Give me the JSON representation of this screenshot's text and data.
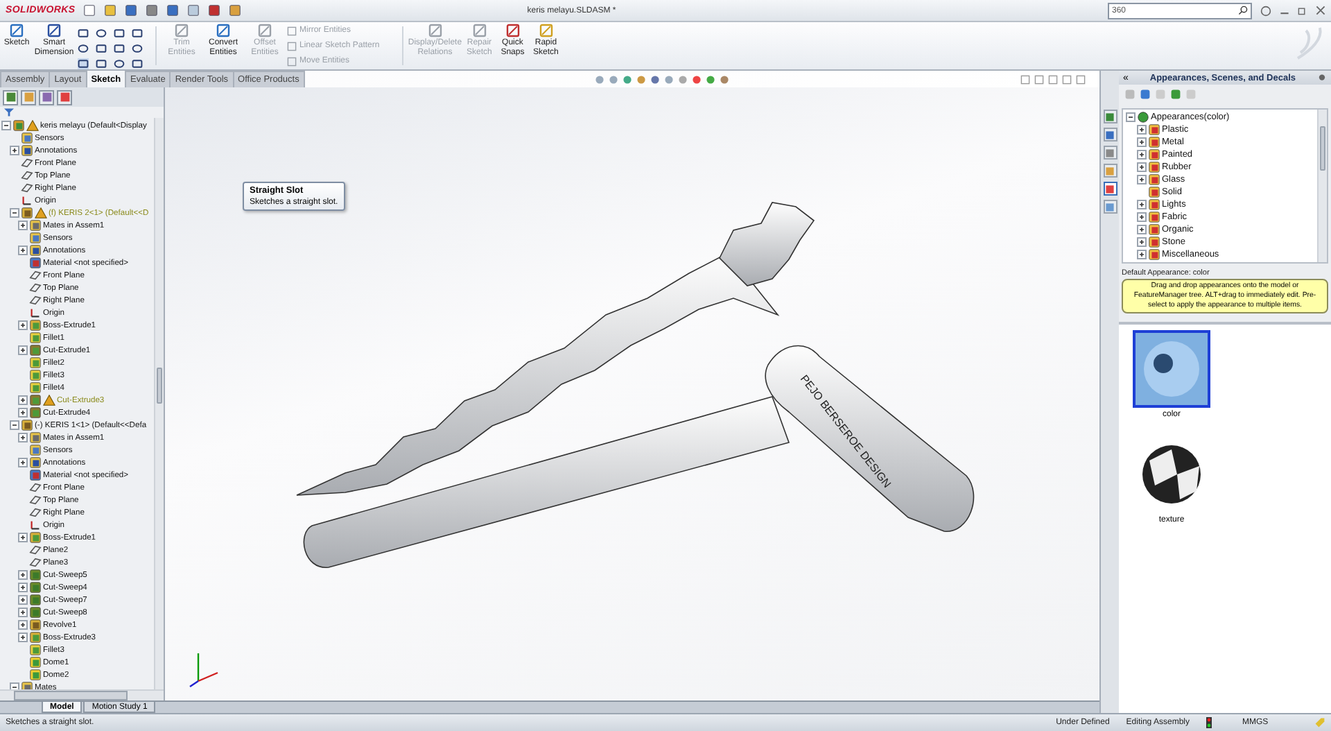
{
  "window": {
    "logo": "SOLIDWORKS",
    "title": "keris melayu.SLDASM *",
    "search": {
      "value": "360"
    }
  },
  "ribbon": {
    "large_buttons": [
      {
        "label": "Sketch",
        "disabled": false,
        "kind": "sketch"
      },
      {
        "label": "Smart Dimension",
        "disabled": false,
        "kind": "dimension"
      }
    ],
    "edit_buttons": [
      {
        "label": "Trim Entities",
        "disabled": true,
        "kind": "trim"
      },
      {
        "label": "Convert Entities",
        "disabled": false,
        "kind": "convert"
      },
      {
        "label": "Offset Entities",
        "disabled": true,
        "kind": "offset"
      }
    ],
    "small_buttons": [
      {
        "label": "Mirror Entities",
        "disabled": true
      },
      {
        "label": "Linear Sketch Pattern",
        "disabled": true
      },
      {
        "label": "Move Entities",
        "disabled": true
      }
    ],
    "relation_buttons": [
      {
        "label": "Display/Delete Relations",
        "disabled": true,
        "kind": "relations"
      },
      {
        "label": "Repair Sketch",
        "disabled": true,
        "kind": "repair"
      },
      {
        "label": "Quick Snaps",
        "disabled": false,
        "kind": "snaps"
      },
      {
        "label": "Rapid Sketch",
        "disabled": false,
        "kind": "rapid"
      }
    ]
  },
  "tabs": [
    {
      "label": "Assembly",
      "selected": false
    },
    {
      "label": "Layout",
      "selected": false
    },
    {
      "label": "Sketch",
      "selected": true
    },
    {
      "label": "Evaluate",
      "selected": false
    },
    {
      "label": "Render Tools",
      "selected": false
    },
    {
      "label": "Office Products",
      "selected": false
    }
  ],
  "tooltip": {
    "title": "Straight Slot",
    "text": "Sketches a straight slot."
  },
  "feature_tree": [
    {
      "label": "keris melayu (Default<Display",
      "kind": "assembly",
      "warning": true,
      "warning_text": false,
      "expanded": true,
      "children": [
        {
          "label": "Sensors",
          "kind": "sensor"
        },
        {
          "label": "Annotations",
          "kind": "annotation",
          "expanded": false
        },
        {
          "label": "Front Plane",
          "kind": "plane"
        },
        {
          "label": "Top Plane",
          "kind": "plane"
        },
        {
          "label": "Right Plane",
          "kind": "plane"
        },
        {
          "label": "Origin",
          "kind": "origin"
        },
        {
          "label": "(f) KERIS 2<1> (Default<<D",
          "kind": "part",
          "warning": true,
          "warning_text": true,
          "expanded": true,
          "children": [
            {
              "label": "Mates in Assem1",
              "kind": "mates",
              "expanded": false
            },
            {
              "label": "Sensors",
              "kind": "sensor"
            },
            {
              "label": "Annotations",
              "kind": "annotation",
              "expanded": false
            },
            {
              "label": "Material <not specified>",
              "kind": "material"
            },
            {
              "label": "Front Plane",
              "kind": "plane"
            },
            {
              "label": "Top Plane",
              "kind": "plane"
            },
            {
              "label": "Right Plane",
              "kind": "plane"
            },
            {
              "label": "Origin",
              "kind": "origin"
            },
            {
              "label": "Boss-Extrude1",
              "kind": "boss",
              "expanded": false
            },
            {
              "label": "Fillet1",
              "kind": "fillet"
            },
            {
              "label": "Cut-Extrude1",
              "kind": "cut",
              "expanded": false
            },
            {
              "label": "Fillet2",
              "kind": "fillet"
            },
            {
              "label": "Fillet3",
              "kind": "fillet"
            },
            {
              "label": "Fillet4",
              "kind": "fillet"
            },
            {
              "label": "Cut-Extrude3",
              "kind": "cut",
              "warning": true,
              "warning_text": true,
              "expanded": false
            },
            {
              "label": "Cut-Extrude4",
              "kind": "cut",
              "expanded": false
            }
          ]
        },
        {
          "label": "(-) KERIS 1<1> (Default<<Defa",
          "kind": "part",
          "expanded": true,
          "children": [
            {
              "label": "Mates in Assem1",
              "kind": "mates",
              "expanded": false
            },
            {
              "label": "Sensors",
              "kind": "sensor"
            },
            {
              "label": "Annotations",
              "kind": "annotation",
              "expanded": false
            },
            {
              "label": "Material <not specified>",
              "kind": "material"
            },
            {
              "label": "Front Plane",
              "kind": "plane"
            },
            {
              "label": "Top Plane",
              "kind": "plane"
            },
            {
              "label": "Right Plane",
              "kind": "plane"
            },
            {
              "label": "Origin",
              "kind": "origin"
            },
            {
              "label": "Boss-Extrude1",
              "kind": "boss",
              "expanded": false
            },
            {
              "label": "Plane2",
              "kind": "plane"
            },
            {
              "label": "Plane3",
              "kind": "plane"
            },
            {
              "label": "Cut-Sweep5",
              "kind": "sweep",
              "expanded": false
            },
            {
              "label": "Cut-Sweep4",
              "kind": "sweep",
              "expanded": false
            },
            {
              "label": "Cut-Sweep7",
              "kind": "sweep",
              "expanded": false
            },
            {
              "label": "Cut-Sweep8",
              "kind": "sweep",
              "expanded": false
            },
            {
              "label": "Revolve1",
              "kind": "revolve",
              "expanded": false
            },
            {
              "label": "Boss-Extrude3",
              "kind": "boss",
              "expanded": false
            },
            {
              "label": "Fillet3",
              "kind": "fillet"
            },
            {
              "label": "Dome1",
              "kind": "dome"
            },
            {
              "label": "Dome2",
              "kind": "dome"
            }
          ]
        },
        {
          "label": "Mates",
          "kind": "mates",
          "expanded": true
        }
      ]
    }
  ],
  "viewport": {
    "engraving": "PEJO BERSEROE DESIGN"
  },
  "task_pane_tabs": [
    {
      "selected": false
    },
    {
      "selected": false
    },
    {
      "selected": false
    },
    {
      "selected": false
    },
    {
      "selected": true
    },
    {
      "selected": false
    }
  ],
  "appearances_panel": {
    "collapse": "«",
    "title": "Appearances, Scenes, and Decals",
    "tree": {
      "label": "Appearances(color)",
      "expanded": true,
      "children": [
        {
          "label": "Plastic",
          "expanded": false
        },
        {
          "label": "Metal",
          "expanded": false
        },
        {
          "label": "Painted",
          "expanded": false
        },
        {
          "label": "Rubber",
          "expanded": false
        },
        {
          "label": "Glass",
          "expanded": false
        },
        {
          "label": "Solid"
        },
        {
          "label": "Lights",
          "expanded": false
        },
        {
          "label": "Fabric",
          "expanded": false
        },
        {
          "label": "Organic",
          "expanded": false
        },
        {
          "label": "Stone",
          "expanded": false
        },
        {
          "label": "Miscellaneous",
          "expanded": false
        }
      ]
    },
    "default_appearance": "Default Appearance: color",
    "hint": "Drag and drop appearances onto the model or FeatureManager tree.  ALT+drag to immediately edit. Pre-select to apply the appearance to multiple items.",
    "swatches": [
      {
        "label": "color",
        "kind": "color",
        "selected": true
      },
      {
        "label": "texture",
        "kind": "texture",
        "selected": false
      }
    ]
  },
  "bottom_tabs": [
    {
      "label": "Model",
      "selected": true
    },
    {
      "label": "Motion Study 1",
      "selected": false
    }
  ],
  "status_bar": {
    "message": "Sketches a straight slot.",
    "sketch_state": "Under Defined",
    "mode": "Editing Assembly",
    "units": "MMGS"
  }
}
